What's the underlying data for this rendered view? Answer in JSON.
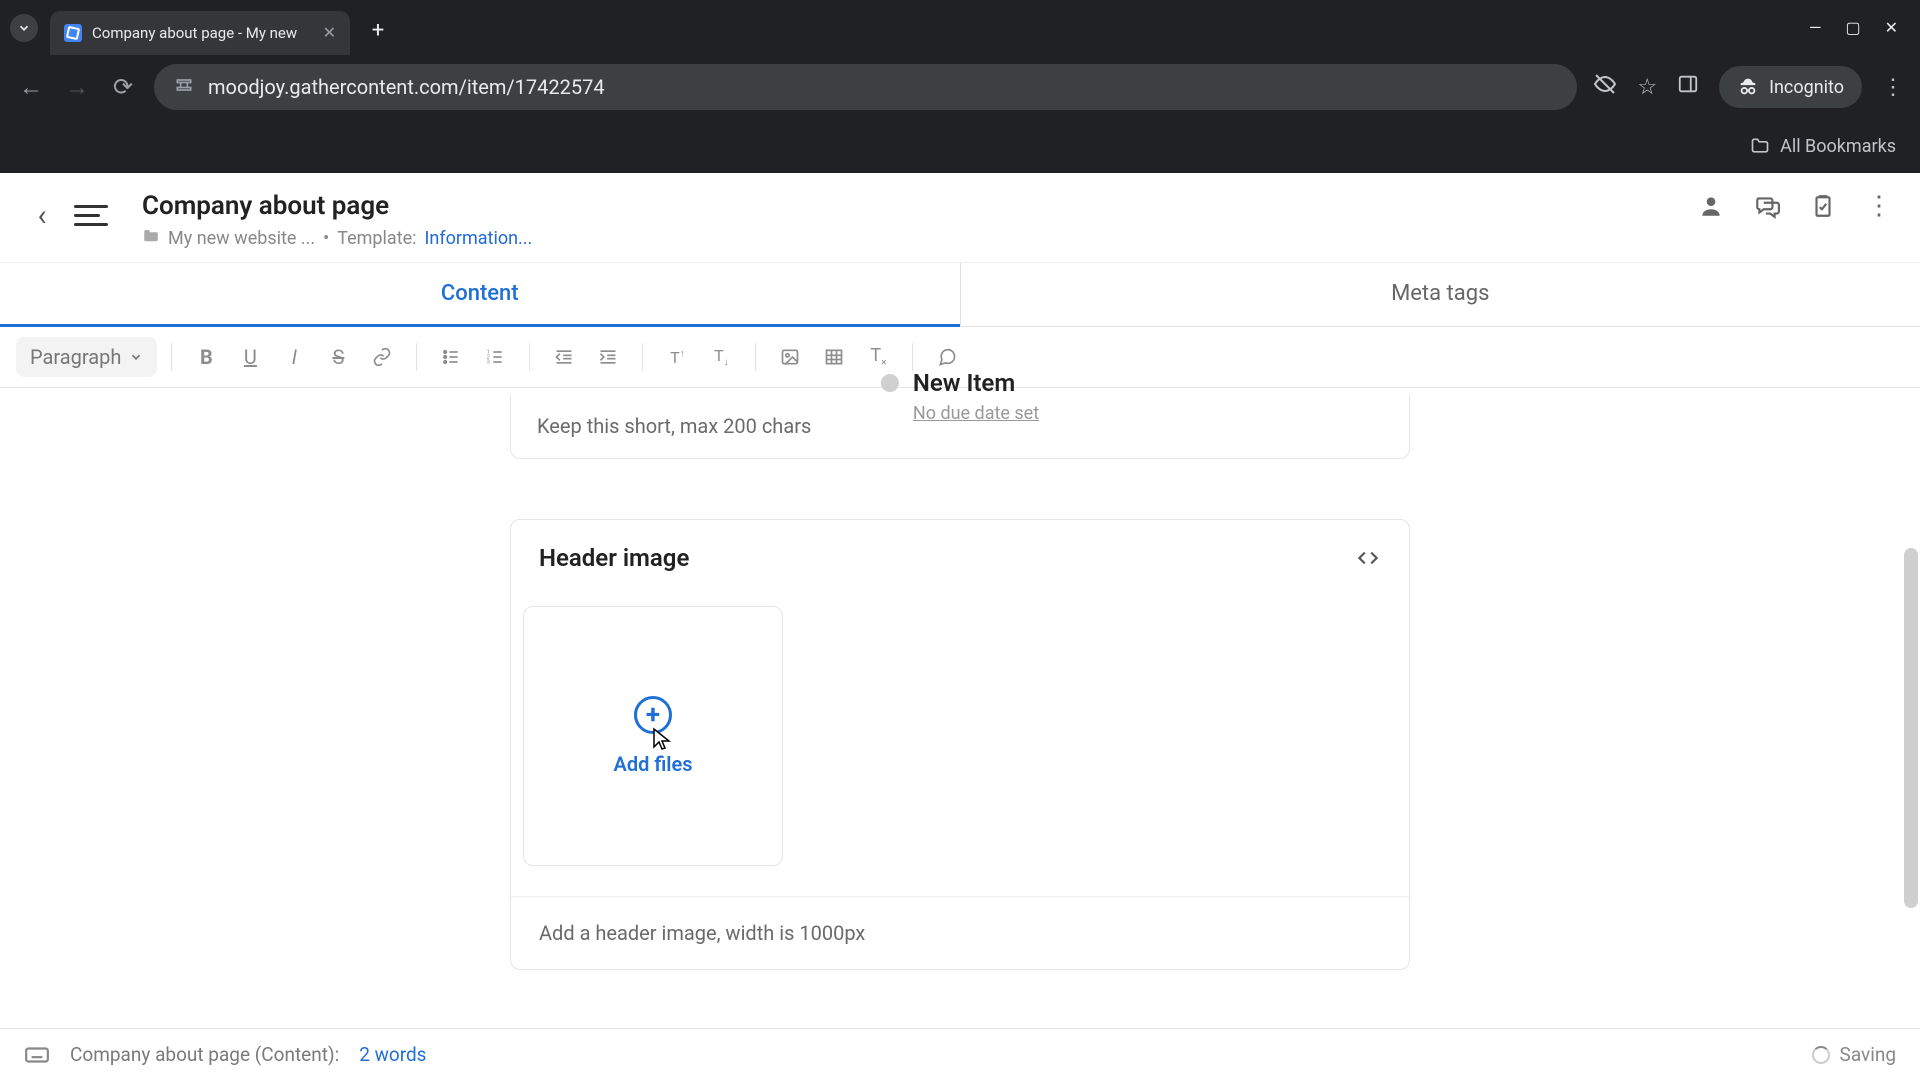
{
  "browser": {
    "tab_title": "Company about page - My new",
    "url": "moodjoy.gathercontent.com/item/17422574",
    "incognito_label": "Incognito",
    "all_bookmarks": "All Bookmarks"
  },
  "header": {
    "page_title": "Company about page",
    "project_crumb": "My new website ...",
    "template_prefix": "Template:",
    "template_name": "Information...",
    "status_label": "New Item",
    "due_text": "No due date set"
  },
  "tabs": [
    {
      "label": "Content",
      "active": true
    },
    {
      "label": "Meta tags",
      "active": false
    }
  ],
  "toolbar": {
    "format_label": "Paragraph"
  },
  "content": {
    "short_hint": "Keep this short, max 200 chars",
    "header_image_title": "Header image",
    "add_files_label": "Add files",
    "header_image_hint": "Add a header image, width is 1000px"
  },
  "footer": {
    "context_label": "Company about page (Content):",
    "word_count_label": "2 words",
    "saving_label": "Saving"
  }
}
